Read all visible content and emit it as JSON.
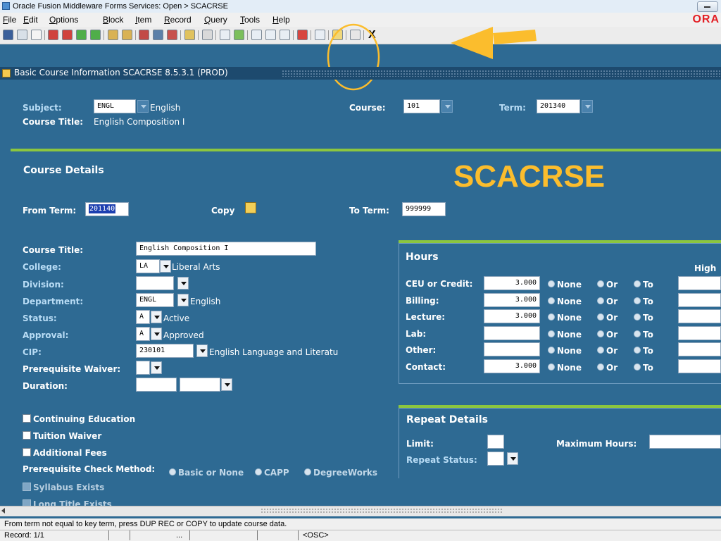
{
  "window": {
    "title": "Oracle Fusion Middleware Forms Services: Open > SCACRSE",
    "logo": "ORA"
  },
  "menu": {
    "items": [
      {
        "u": "F",
        "rest": "ile"
      },
      {
        "u": "E",
        "rest": "dit"
      },
      {
        "u": "O",
        "rest": "ptions"
      },
      {
        "u": "B",
        "rest": "lock"
      },
      {
        "u": "I",
        "rest": "tem"
      },
      {
        "u": "R",
        "rest": "ecord"
      },
      {
        "u": "Q",
        "rest": "uery"
      },
      {
        "u": "T",
        "rest": "ools"
      },
      {
        "u": "H",
        "rest": "elp"
      }
    ]
  },
  "toolbar": {
    "exit_label": "X"
  },
  "form": {
    "title": "Basic Course Information  SCACRSE  8.5.3.1  (PROD)"
  },
  "key_block": {
    "subject_label": "Subject:",
    "subject_value": "ENGL",
    "subject_desc": "English",
    "course_label": "Course:",
    "course_value": "101",
    "term_label": "Term:",
    "term_value": "201340",
    "course_title_label": "Course Title:",
    "course_title_value": "English Composition I"
  },
  "annotation": {
    "text": "SCACRSE",
    "color": "#fbbd2d"
  },
  "course_details": {
    "title": "Course Details",
    "from_term_label": "From Term:",
    "from_term_value": "201140",
    "copy_label": "Copy",
    "to_term_label": "To Term:",
    "to_term_value": "999999",
    "fields": {
      "course_title": {
        "label": "Course Title:",
        "value": "English Composition I"
      },
      "college": {
        "label": "College:",
        "value": "LA",
        "desc": "Liberal Arts"
      },
      "division": {
        "label": "Division:",
        "value": ""
      },
      "department": {
        "label": "Department:",
        "value": "ENGL",
        "desc": "English"
      },
      "status": {
        "label": "Status:",
        "value": "A",
        "desc": "Active"
      },
      "approval": {
        "label": "Approval:",
        "value": "A",
        "desc": "Approved"
      },
      "cip": {
        "label": "CIP:",
        "value": "230101",
        "desc": "English Language and Literatu"
      },
      "prereq_waiver": {
        "label": "Prerequisite Waiver:",
        "value": ""
      },
      "duration": {
        "label": "Duration:",
        "value": ""
      }
    },
    "checkboxes": {
      "continuing_education": "Continuing Education",
      "tuition_waiver": "Tuition Waiver",
      "additional_fees": "Additional Fees",
      "syllabus_exists": "Syllabus Exists",
      "long_title_exists": "Long Title Exists"
    },
    "prereq_method": {
      "label": "Prerequisite Check Method:",
      "options": [
        "Basic or None",
        "CAPP",
        "DegreeWorks"
      ]
    }
  },
  "hours": {
    "title": "Hours",
    "high_label": "High",
    "radio_none": "None",
    "radio_or": "Or",
    "radio_to": "To",
    "rows": [
      {
        "label": "CEU or Credit:",
        "value": "3.000"
      },
      {
        "label": "Billing:",
        "value": "3.000"
      },
      {
        "label": "Lecture:",
        "value": "3.000"
      },
      {
        "label": "Lab:",
        "value": ""
      },
      {
        "label": "Other:",
        "value": ""
      },
      {
        "label": "Contact:",
        "value": "3.000"
      }
    ]
  },
  "repeat": {
    "title": "Repeat Details",
    "limit_label": "Limit:",
    "max_hours_label": "Maximum Hours:",
    "repeat_status_label": "Repeat Status:"
  },
  "status": {
    "message": "From term not equal to key term, press DUP REC or COPY to update course data.",
    "record": "Record: 1/1",
    "ellipsis": "...",
    "osc": "<OSC>"
  }
}
